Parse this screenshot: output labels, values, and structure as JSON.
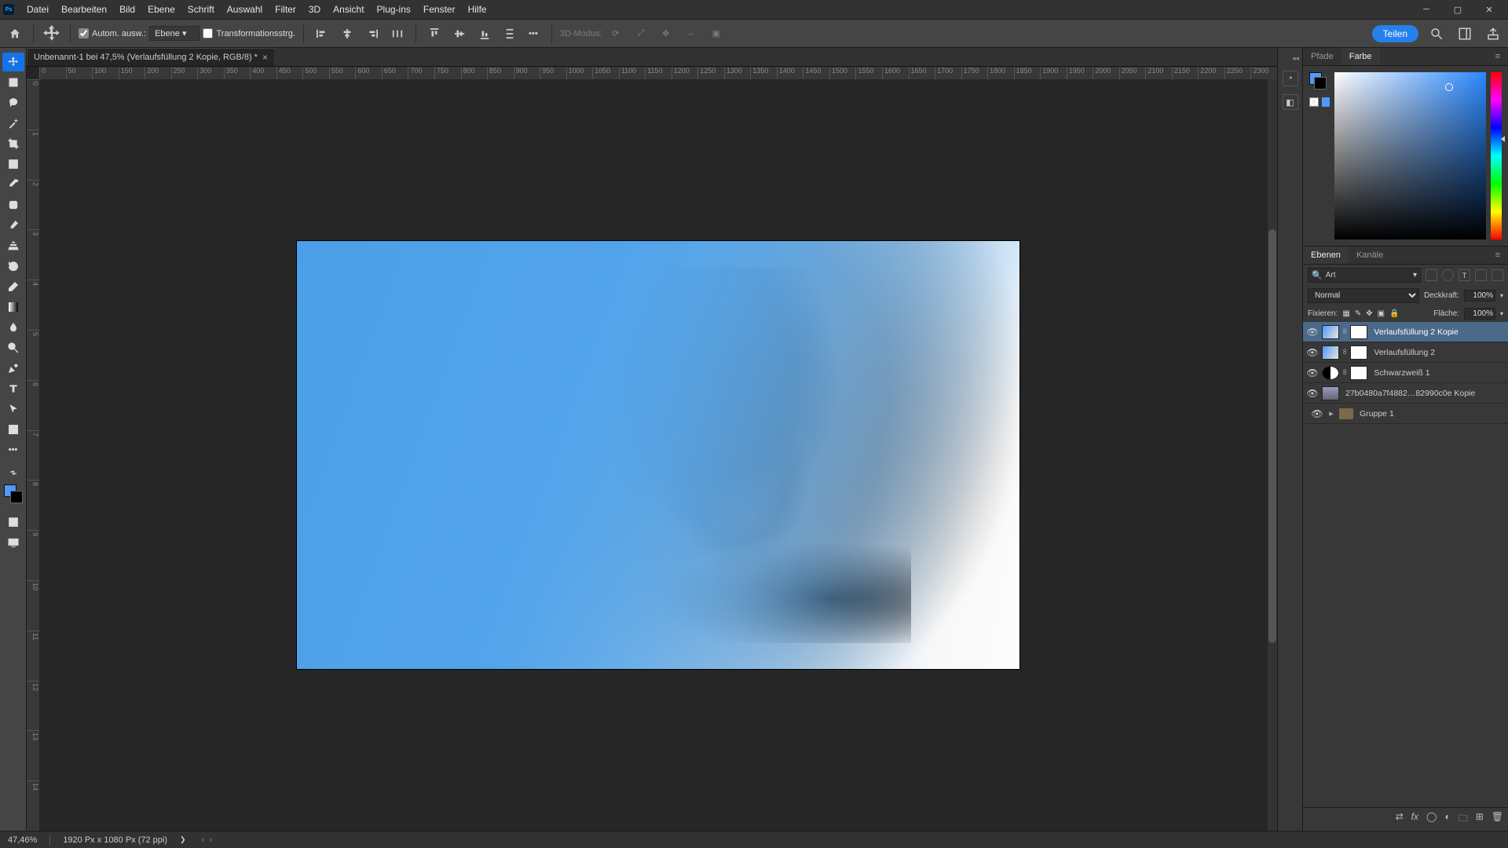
{
  "menu": {
    "items": [
      "Datei",
      "Bearbeiten",
      "Bild",
      "Ebene",
      "Schrift",
      "Auswahl",
      "Filter",
      "3D",
      "Ansicht",
      "Plug-ins",
      "Fenster",
      "Hilfe"
    ]
  },
  "options_bar": {
    "auto_select_label": "Autom. ausw.:",
    "auto_select_target": "Ebene",
    "transform_ctrl_label": "Transformationsstrg.",
    "mode_3d_label": "3D-Modus:",
    "share_label": "Teilen"
  },
  "document_tab": {
    "title": "Unbenannt-1 bei 47,5% (Verlaufsfüllung 2 Kopie, RGB/8) *"
  },
  "ruler_h": [
    "0",
    "50",
    "100",
    "150",
    "200",
    "250",
    "300",
    "350",
    "400",
    "450",
    "500",
    "550",
    "600",
    "650",
    "700",
    "750",
    "800",
    "850",
    "900",
    "950",
    "1000",
    "1050",
    "1100",
    "1150",
    "1200",
    "1250",
    "1300",
    "1350",
    "1400",
    "1450",
    "1500",
    "1550",
    "1600",
    "1650",
    "1700",
    "1750",
    "1800",
    "1850",
    "1900",
    "1950",
    "2000",
    "2050",
    "2100",
    "2150",
    "2200",
    "2250",
    "2300"
  ],
  "ruler_v": [
    "0",
    "1",
    "2",
    "3",
    "4",
    "5",
    "6",
    "7",
    "8",
    "9",
    "10",
    "11",
    "12",
    "13",
    "14"
  ],
  "color_panel": {
    "tabs": [
      "Pfade",
      "Farbe"
    ],
    "active": 1
  },
  "layers_panel": {
    "tabs": [
      "Ebenen",
      "Kanäle"
    ],
    "active": 0,
    "filter_label": "Art",
    "blend_mode": "Normal",
    "opacity_label": "Deckkraft:",
    "opacity_value": "100%",
    "lock_label": "Fixieren:",
    "fill_label": "Fläche:",
    "fill_value": "100%",
    "layers": [
      {
        "name": "Verlaufsfüllung 2 Kopie",
        "visible": true,
        "selected": true,
        "type": "gradient"
      },
      {
        "name": "Verlaufsfüllung 2",
        "visible": true,
        "selected": false,
        "type": "gradient"
      },
      {
        "name": "Schwarzweiß 1",
        "visible": true,
        "selected": false,
        "type": "bw"
      },
      {
        "name": "27b0480a7f4882…82990c0e  Kopie",
        "visible": true,
        "selected": false,
        "type": "image"
      },
      {
        "name": "Gruppe 1",
        "visible": true,
        "selected": false,
        "type": "group"
      }
    ]
  },
  "status_bar": {
    "zoom": "47,46%",
    "doc_info": "1920 Px x 1080 Px (72 ppi)"
  },
  "colors": {
    "accent": "#2680eb",
    "foreground": "#4d9aff",
    "background_swatch": "#000000"
  }
}
